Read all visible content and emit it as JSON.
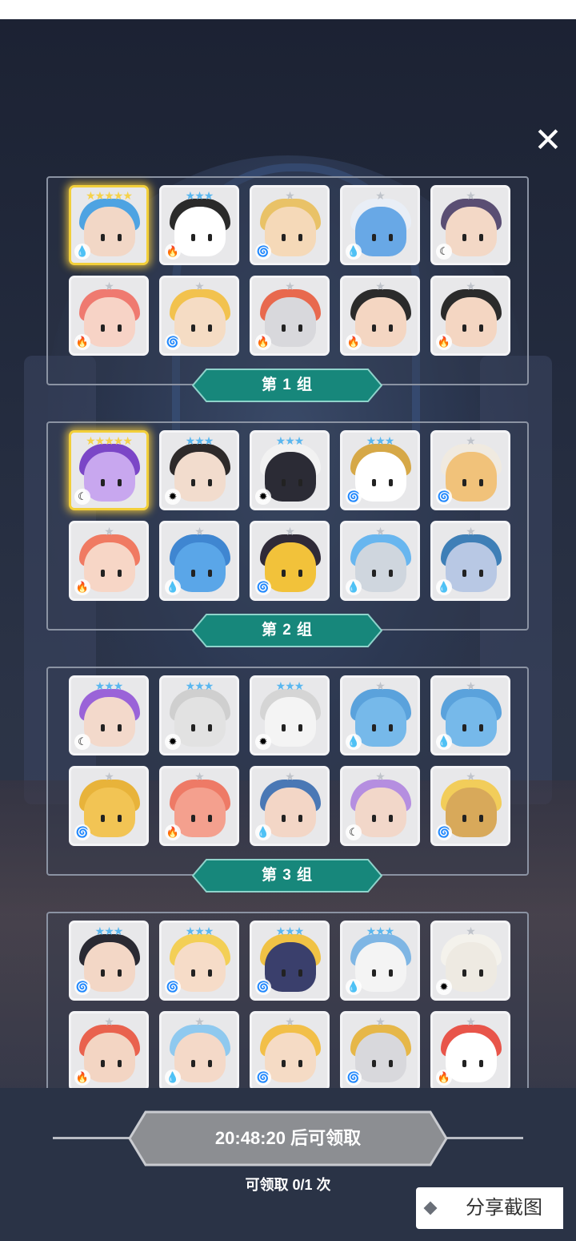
{
  "close_icon": "close-icon",
  "groups": [
    {
      "label": "第 1 组",
      "heroes": [
        {
          "stars": "★★★★★",
          "star_color": "#f6d24a",
          "element": "water",
          "colors": [
            "#f2d7c6",
            "#4ea3e2"
          ],
          "gold": true
        },
        {
          "stars": "★★★",
          "star_color": "#5ab7ef",
          "element": "fire",
          "colors": [
            "#ffffff",
            "#2a2a2a"
          ]
        },
        {
          "stars": "★",
          "star_color": "#bfc3ca",
          "element": "wind",
          "colors": [
            "#f5d9b8",
            "#e9c267"
          ]
        },
        {
          "stars": "★",
          "star_color": "#bfc3ca",
          "element": "water",
          "colors": [
            "#68a8e6",
            "#e9eef6"
          ]
        },
        {
          "stars": "★",
          "star_color": "#bfc3ca",
          "element": "dark",
          "colors": [
            "#f3d8c6",
            "#5a4e73"
          ]
        },
        {
          "stars": "★",
          "star_color": "#bfc3ca",
          "element": "fire",
          "colors": [
            "#f7d3c6",
            "#ef7a70"
          ]
        },
        {
          "stars": "★",
          "star_color": "#bfc3ca",
          "element": "wind",
          "colors": [
            "#f5dcc4",
            "#f2c24e"
          ]
        },
        {
          "stars": "★",
          "star_color": "#bfc3ca",
          "element": "fire",
          "colors": [
            "#d8d8dc",
            "#e8694e"
          ]
        },
        {
          "stars": "★",
          "star_color": "#bfc3ca",
          "element": "fire",
          "colors": [
            "#f4d6c2",
            "#2b2b2b"
          ]
        },
        {
          "stars": "★",
          "star_color": "#bfc3ca",
          "element": "fire",
          "colors": [
            "#f4d6c2",
            "#2b2b2b"
          ]
        }
      ]
    },
    {
      "label": "第 2 组",
      "heroes": [
        {
          "stars": "★★★★★",
          "star_color": "#f6d24a",
          "element": "dark",
          "colors": [
            "#c8a7ef",
            "#7b46c7"
          ],
          "gold": true
        },
        {
          "stars": "★★★",
          "star_color": "#5ab7ef",
          "element": "light",
          "colors": [
            "#f2dccd",
            "#2e2a2a"
          ]
        },
        {
          "stars": "★★★",
          "star_color": "#5ab7ef",
          "element": "light",
          "colors": [
            "#2b2b35",
            "#f2f2f2"
          ]
        },
        {
          "stars": "★★★",
          "star_color": "#5ab7ef",
          "element": "wind",
          "colors": [
            "#ffffff",
            "#d6a847"
          ]
        },
        {
          "stars": "★",
          "star_color": "#bfc3ca",
          "element": "wind",
          "colors": [
            "#f1c27a",
            "#f0eae0"
          ]
        },
        {
          "stars": "★",
          "star_color": "#bfc3ca",
          "element": "fire",
          "colors": [
            "#f7d6c6",
            "#f07a62"
          ]
        },
        {
          "stars": "★",
          "star_color": "#bfc3ca",
          "element": "water",
          "colors": [
            "#5aa6e8",
            "#3f86d1"
          ]
        },
        {
          "stars": "★",
          "star_color": "#bfc3ca",
          "element": "wind",
          "colors": [
            "#f2c23a",
            "#2f2a38"
          ]
        },
        {
          "stars": "★",
          "star_color": "#bfc3ca",
          "element": "water",
          "colors": [
            "#cfd6de",
            "#68b6ef"
          ]
        },
        {
          "stars": "★",
          "star_color": "#bfc3ca",
          "element": "water",
          "colors": [
            "#b8c8e4",
            "#3e7fb7"
          ]
        }
      ]
    },
    {
      "label": "第 3 组",
      "heroes": [
        {
          "stars": "★★★",
          "star_color": "#5ab7ef",
          "element": "dark",
          "colors": [
            "#f3d9cb",
            "#9a63d8"
          ]
        },
        {
          "stars": "★★★",
          "star_color": "#5ab7ef",
          "element": "light",
          "colors": [
            "#e2e2e2",
            "#cfcfcf"
          ]
        },
        {
          "stars": "★★★",
          "star_color": "#5ab7ef",
          "element": "light",
          "colors": [
            "#f4f4f4",
            "#d5d5d5"
          ]
        },
        {
          "stars": "★",
          "star_color": "#bfc3ca",
          "element": "water",
          "colors": [
            "#76b9ea",
            "#5aa2dc"
          ]
        },
        {
          "stars": "★",
          "star_color": "#bfc3ca",
          "element": "water",
          "colors": [
            "#76b9ea",
            "#5aa2dc"
          ]
        },
        {
          "stars": "★",
          "star_color": "#bfc3ca",
          "element": "wind",
          "colors": [
            "#f2c454",
            "#e8b33a"
          ]
        },
        {
          "stars": "★",
          "star_color": "#bfc3ca",
          "element": "fire",
          "colors": [
            "#f4a08e",
            "#ee7a66"
          ]
        },
        {
          "stars": "★",
          "star_color": "#bfc3ca",
          "element": "water",
          "colors": [
            "#f3d6c6",
            "#4a78b5"
          ]
        },
        {
          "stars": "★",
          "star_color": "#bfc3ca",
          "element": "dark",
          "colors": [
            "#f2d7c9",
            "#b58ee0"
          ]
        },
        {
          "stars": "★",
          "star_color": "#bfc3ca",
          "element": "wind",
          "colors": [
            "#d8a95a",
            "#f2cd5a"
          ]
        }
      ]
    },
    {
      "label": "",
      "heroes": [
        {
          "stars": "★★★",
          "star_color": "#5ab7ef",
          "element": "wind",
          "colors": [
            "#f3d7c6",
            "#2a2a33"
          ]
        },
        {
          "stars": "★★★",
          "star_color": "#5ab7ef",
          "element": "wind",
          "colors": [
            "#f6dcc8",
            "#f3cf56"
          ]
        },
        {
          "stars": "★★★",
          "star_color": "#5ab7ef",
          "element": "wind",
          "colors": [
            "#3a3f6c",
            "#f0c245"
          ]
        },
        {
          "stars": "★★★",
          "star_color": "#5ab7ef",
          "element": "water",
          "colors": [
            "#f4f4f4",
            "#7fb6e4"
          ]
        },
        {
          "stars": "★",
          "star_color": "#bfc3ca",
          "element": "light",
          "colors": [
            "#eeeae2",
            "#f4f2ec"
          ]
        },
        {
          "stars": "★",
          "star_color": "#bfc3ca",
          "element": "fire",
          "colors": [
            "#f3d5c3",
            "#e9624e"
          ]
        },
        {
          "stars": "★",
          "star_color": "#bfc3ca",
          "element": "water",
          "colors": [
            "#f4d9c8",
            "#8fc9ef"
          ]
        },
        {
          "stars": "★",
          "star_color": "#bfc3ca",
          "element": "wind",
          "colors": [
            "#f5dbc5",
            "#f2bf48"
          ]
        },
        {
          "stars": "★",
          "star_color": "#bfc3ca",
          "element": "wind",
          "colors": [
            "#d8d8dc",
            "#e6b748"
          ]
        },
        {
          "stars": "★",
          "star_color": "#bfc3ca",
          "element": "fire",
          "colors": [
            "#ffffff",
            "#e8554a"
          ]
        }
      ]
    }
  ],
  "element_icons": {
    "water": "💧",
    "fire": "🔥",
    "wind": "🌀",
    "dark": "☾",
    "light": "✹"
  },
  "claim": {
    "label": "20:48:20 后可领取",
    "count_text": "可领取 0/1 次"
  },
  "share": {
    "label": "分享截图"
  },
  "colors": {
    "banner": "#17877b",
    "banner_border": "#8fd3cb",
    "claim_button": "#8c8e92"
  }
}
